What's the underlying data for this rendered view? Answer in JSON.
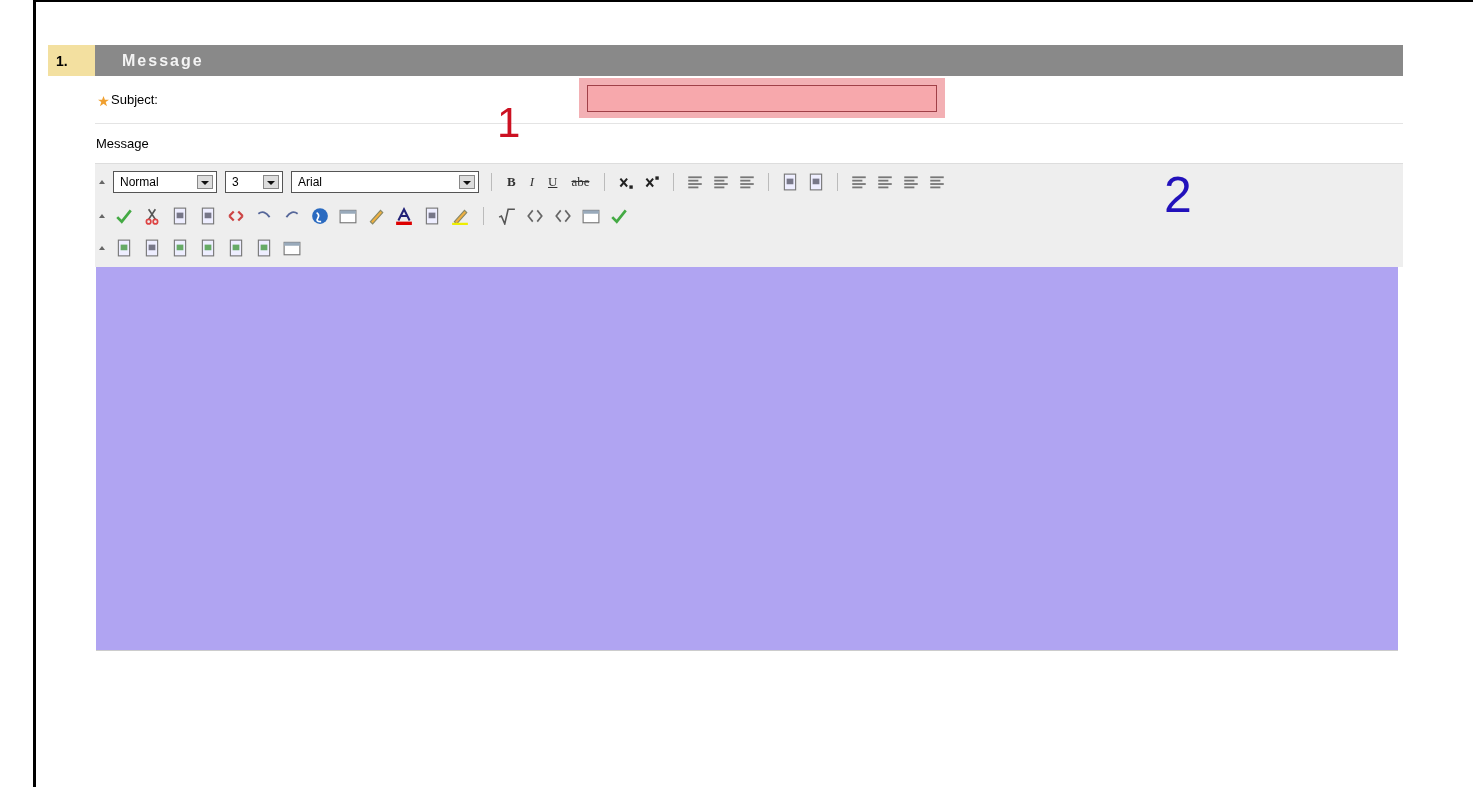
{
  "section": {
    "number": "1.",
    "title": "Message"
  },
  "subject": {
    "label": "Subject:",
    "required": true
  },
  "message_label": "Message",
  "toolbar": {
    "format": "Normal",
    "size": "3",
    "font": "Arial",
    "text_buttons": [
      "B",
      "I",
      "U",
      "abe"
    ]
  },
  "annotations": [
    {
      "label": "1",
      "color": "#cc1122"
    },
    {
      "label": "2",
      "color": "#2211bb"
    }
  ]
}
